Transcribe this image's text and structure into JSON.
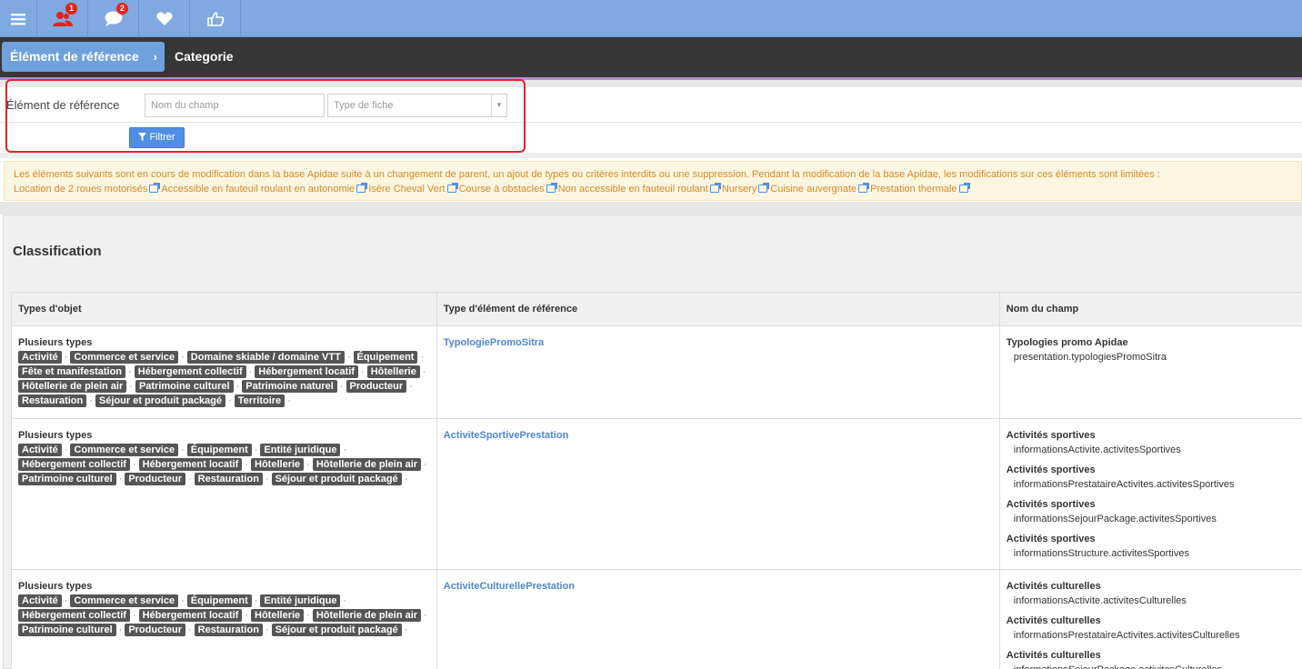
{
  "toolbar": {
    "items": [
      {
        "icon": "menu-icon"
      },
      {
        "icon": "users-icon",
        "badge": "1"
      },
      {
        "icon": "chat-icon",
        "badge": "2"
      },
      {
        "icon": "heart-icon"
      },
      {
        "icon": "thumbs-up-icon"
      }
    ]
  },
  "breadcrumb": {
    "first": "Élément de référence",
    "second": "Categorie"
  },
  "filter": {
    "label": "Élément de référence",
    "name_placeholder": "Nom du champ",
    "type_placeholder": "Type de fiche",
    "button_label": "Filtrer"
  },
  "warning": {
    "text": "Les éléments suivants sont en cours de modification dans la base Apidae suite à un changement de parent, un ajout de types ou critères interdits ou une suppression. Pendant la modification de la base Apidae, les modifications sur ces éléments sont limitées :",
    "links": [
      "Location de 2 roues motorisés",
      "Accessible en fauteuil roulant en autonomie",
      "Isère Cheval Vert",
      "Course à obstacles",
      "Non accessible en fauteuil roulant",
      "Nursery",
      "Cuisine auvergnate",
      "Prestation thermale"
    ]
  },
  "panel": {
    "title": "Classification",
    "columns": [
      "Types d'objet",
      "Type d'élément de référence",
      "Nom du champ"
    ],
    "rows": [
      {
        "types_title": "Plusieurs types",
        "tag_lines": [
          [
            "Activité",
            "Commerce et service",
            "Domaine skiable / domaine VTT",
            "Équipement"
          ],
          [
            "Fête et manifestation",
            "Hébergement collectif",
            "Hébergement locatif",
            "Hôtellerie"
          ],
          [
            "Hôtellerie de plein air",
            "Patrimoine culturel",
            "Patrimoine naturel",
            "Producteur"
          ],
          [
            "Restauration",
            "Séjour et produit packagé",
            "Territoire"
          ]
        ],
        "ref_type": "TypologiePromoSitra",
        "fields": [
          {
            "name": "Typologies promo Apidae",
            "path": "presentation.typologiesPromoSitra"
          }
        ]
      },
      {
        "types_title": "Plusieurs types",
        "tag_lines": [
          [
            "Activité",
            "Commerce et service",
            "Équipement",
            "Entité juridique"
          ],
          [
            "Hébergement collectif",
            "Hébergement locatif",
            "Hôtellerie",
            "Hôtellerie de plein air"
          ],
          [
            "Patrimoine culturel",
            "Producteur",
            "Restauration",
            "Séjour et produit packagé"
          ]
        ],
        "ref_type": "ActiviteSportivePrestation",
        "fields": [
          {
            "name": "Activités sportives",
            "path": "informationsActivite.activitesSportives"
          },
          {
            "name": "Activités sportives",
            "path": "informationsPrestataireActivites.activitesSportives"
          },
          {
            "name": "Activités sportives",
            "path": "informationsSejourPackage.activitesSportives"
          },
          {
            "name": "Activités sportives",
            "path": "informationsStructure.activitesSportives"
          }
        ]
      },
      {
        "types_title": "Plusieurs types",
        "tag_lines": [
          [
            "Activité",
            "Commerce et service",
            "Équipement",
            "Entité juridique"
          ],
          [
            "Hébergement collectif",
            "Hébergement locatif",
            "Hôtellerie",
            "Hôtellerie de plein air"
          ],
          [
            "Patrimoine culturel",
            "Producteur",
            "Restauration",
            "Séjour et produit packagé"
          ]
        ],
        "ref_type": "ActiviteCulturellePrestation",
        "fields": [
          {
            "name": "Activités culturelles",
            "path": "informationsActivite.activitesCulturelles"
          },
          {
            "name": "Activités culturelles",
            "path": "informationsPrestataireActivites.activitesCulturelles"
          },
          {
            "name": "Activités culturelles",
            "path": "informationsSejourPackage.activitesCulturelles"
          }
        ]
      }
    ]
  }
}
